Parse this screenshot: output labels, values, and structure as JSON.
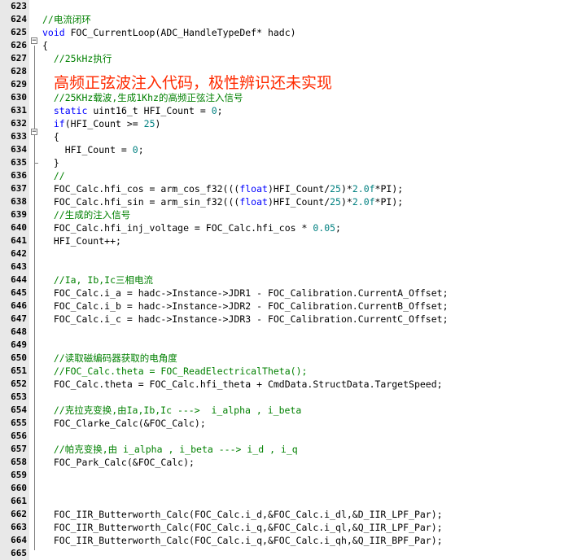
{
  "lines": [
    {
      "n": "623",
      "text": ""
    },
    {
      "n": "624",
      "text": "//电流闭环"
    },
    {
      "n": "625",
      "text": "void FOC_CurrentLoop(ADC_HandleTypeDef* hadc)"
    },
    {
      "n": "626",
      "text": "{"
    },
    {
      "n": "627",
      "text": "  //25kHz执行"
    },
    {
      "n": "628",
      "text": ""
    },
    {
      "n": "629",
      "text": "高频正弦波注入代码，极性辨识还未实现"
    },
    {
      "n": "630",
      "text": "  //25KHz载波,生成1Khz的高频正弦注入信号"
    },
    {
      "n": "631",
      "text": "  static uint16_t HFI_Count = 0;"
    },
    {
      "n": "632",
      "text": "  if(HFI_Count >= 25)"
    },
    {
      "n": "633",
      "text": "  {"
    },
    {
      "n": "634",
      "text": "    HFI_Count = 0;"
    },
    {
      "n": "635",
      "text": "  }"
    },
    {
      "n": "636",
      "text": "  //"
    },
    {
      "n": "637",
      "text": "  FOC_Calc.hfi_cos = arm_cos_f32(((float)HFI_Count/25)*2.0f*PI);"
    },
    {
      "n": "638",
      "text": "  FOC_Calc.hfi_sin = arm_sin_f32(((float)HFI_Count/25)*2.0f*PI);"
    },
    {
      "n": "639",
      "text": "  //生成的注入信号"
    },
    {
      "n": "640",
      "text": "  FOC_Calc.hfi_inj_voltage = FOC_Calc.hfi_cos * 0.05;"
    },
    {
      "n": "641",
      "text": "  HFI_Count++;"
    },
    {
      "n": "642",
      "text": ""
    },
    {
      "n": "643",
      "text": ""
    },
    {
      "n": "644",
      "text": "  //Ia, Ib,Ic三相电流"
    },
    {
      "n": "645",
      "text": "  FOC_Calc.i_a = hadc->Instance->JDR1 - FOC_Calibration.CurrentA_Offset;"
    },
    {
      "n": "646",
      "text": "  FOC_Calc.i_b = hadc->Instance->JDR2 - FOC_Calibration.CurrentB_Offset;"
    },
    {
      "n": "647",
      "text": "  FOC_Calc.i_c = hadc->Instance->JDR3 - FOC_Calibration.CurrentC_Offset;"
    },
    {
      "n": "648",
      "text": ""
    },
    {
      "n": "649",
      "text": ""
    },
    {
      "n": "650",
      "text": "  //读取磁编码器获取的电角度"
    },
    {
      "n": "651",
      "text": "  //FOC_Calc.theta = FOC_ReadElectricalTheta();"
    },
    {
      "n": "652",
      "text": "  FOC_Calc.theta = FOC_Calc.hfi_theta + CmdData.StructData.TargetSpeed;"
    },
    {
      "n": "653",
      "text": ""
    },
    {
      "n": "654",
      "text": "  //克拉克变换,由Ia,Ib,Ic --->  i_alpha , i_beta"
    },
    {
      "n": "655",
      "text": "  FOC_Clarke_Calc(&FOC_Calc);"
    },
    {
      "n": "656",
      "text": ""
    },
    {
      "n": "657",
      "text": "  //帕克变换,由 i_alpha , i_beta ---> i_d , i_q"
    },
    {
      "n": "658",
      "text": "  FOC_Park_Calc(&FOC_Calc);"
    },
    {
      "n": "659",
      "text": ""
    },
    {
      "n": "660",
      "text": ""
    },
    {
      "n": "661",
      "text": ""
    },
    {
      "n": "662",
      "text": "  FOC_IIR_Butterworth_Calc(FOC_Calc.i_d,&FOC_Calc.i_dl,&D_IIR_LPF_Par);"
    },
    {
      "n": "663",
      "text": "  FOC_IIR_Butterworth_Calc(FOC_Calc.i_q,&FOC_Calc.i_ql,&Q_IIR_LPF_Par);"
    },
    {
      "n": "664",
      "text": "  FOC_IIR_Butterworth_Calc(FOC_Calc.i_q,&FOC_Calc.i_qh,&Q_IIR_BPF_Par);"
    },
    {
      "n": "665",
      "text": ""
    }
  ],
  "colors": {
    "comment": "#008000",
    "keyword": "#0000ff",
    "number": "#008080",
    "annotation": "#ff2a00",
    "gutter": "#e8e8e8"
  },
  "fold_icons": [
    "minus-box-icon",
    "minus-box-icon"
  ]
}
